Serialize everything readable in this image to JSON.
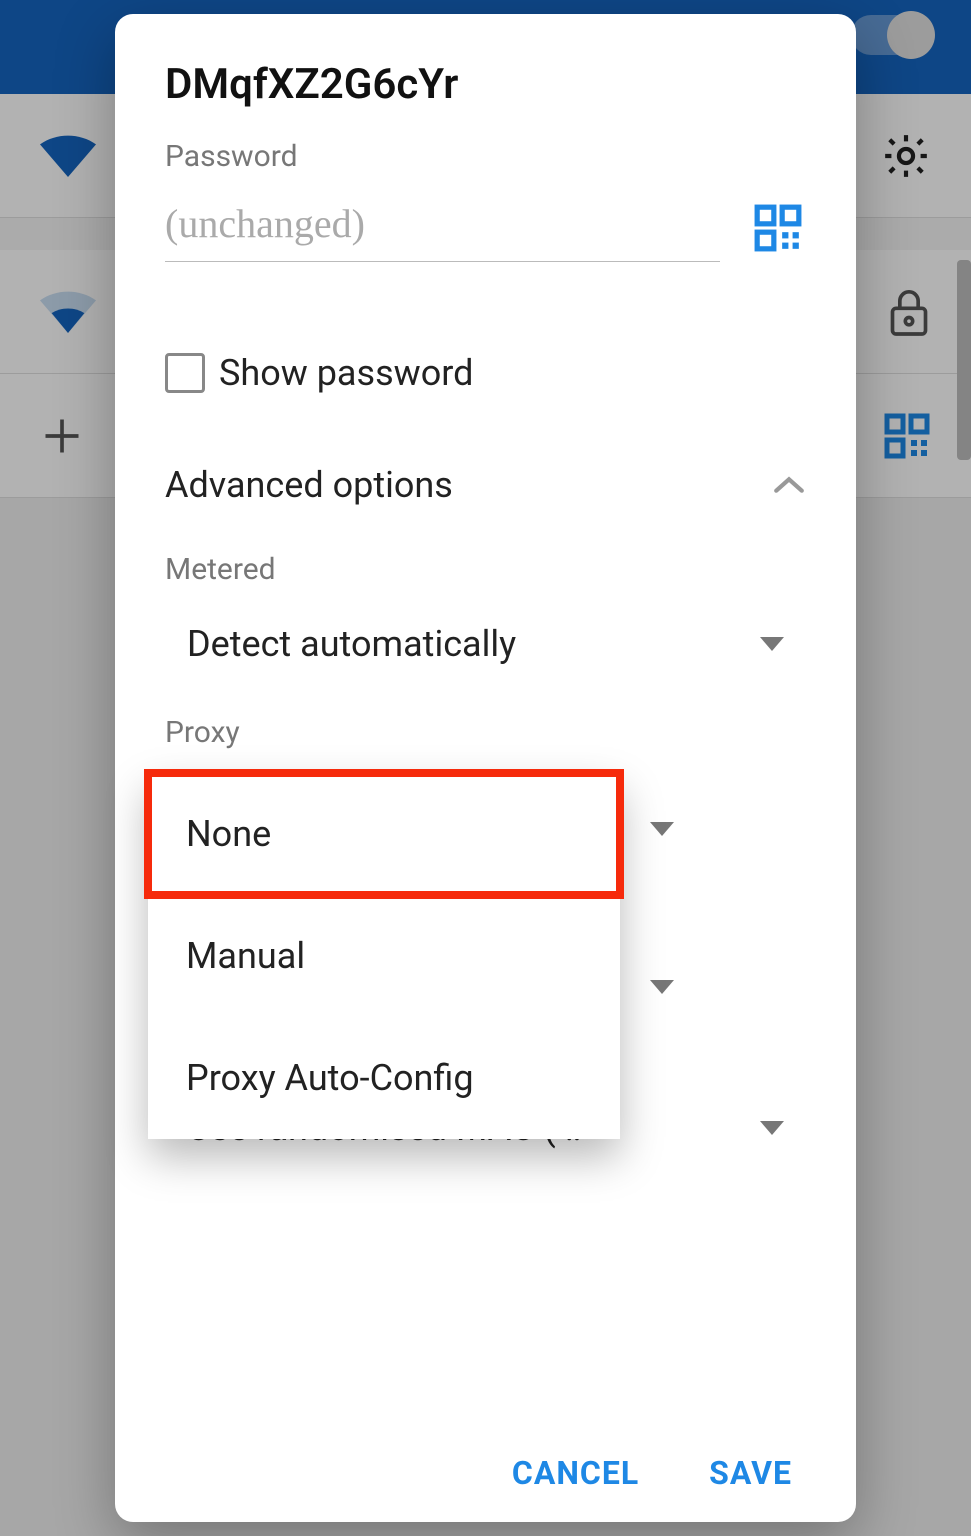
{
  "dialog": {
    "title": "DMqfXZ2G6cYr",
    "password_label": "Password",
    "password_placeholder": "(unchanged)",
    "show_password_label": "Show password",
    "advanced_label": "Advanced options",
    "metered": {
      "label": "Metered",
      "value": "Detect automatically"
    },
    "proxy": {
      "label": "Proxy",
      "options": [
        "None",
        "Manual",
        "Proxy Auto-Config"
      ],
      "selected_index": 0
    },
    "privacy": {
      "value": "Use randomised MAC ( ‥"
    },
    "actions": {
      "cancel": "CANCEL",
      "save": "SAVE"
    }
  },
  "colors": {
    "accent": "#1e88e5",
    "highlight_border": "#f62a0b",
    "topbar": "#1565c0"
  }
}
